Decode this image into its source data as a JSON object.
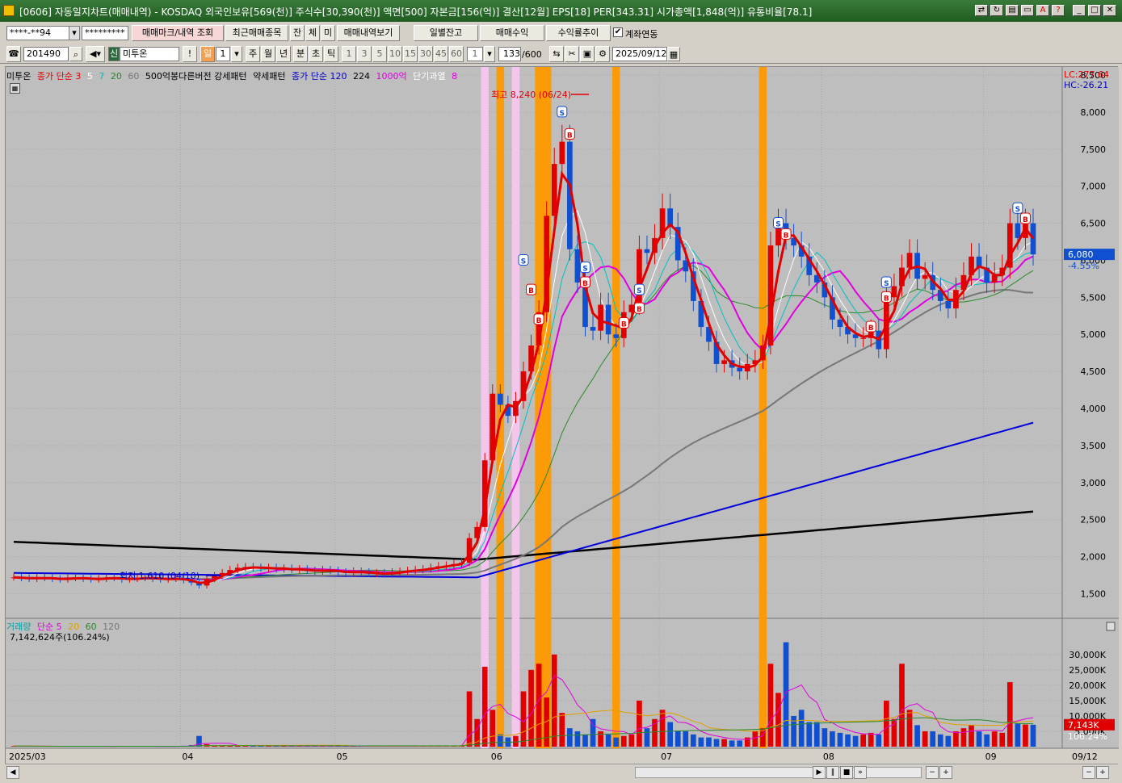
{
  "window": {
    "title": "[0606] 자동일지차트(매매내역) - KOSDAQ 외국인보유[569(천)] 주식수[30,390(천)] 액면[500] 자본금[156(억)] 결산[12월] EPS[18] PER[343.31] 시가총액[1,848(억)] 유통비율[78.1]"
  },
  "toolbar1": {
    "account": "****-**94",
    "password": "*********",
    "trade_mark_btn": "매매마크/내역 조회",
    "recent_trades_btn": "최근매매종목",
    "jan_btn": "잔",
    "che_btn": "체",
    "mi_btn": "미",
    "history_btn": "매매내역보기",
    "daily_balance_btn": "일별잔고",
    "trade_profit_btn": "매매수익",
    "return_trend_btn": "수익률추이",
    "account_link_label": "계좌연동",
    "account_link_checked": "✔"
  },
  "toolbar2": {
    "code": "201490",
    "badge": "신",
    "name": "미투온",
    "period_buttons": [
      "일",
      "1",
      "주",
      "월",
      "년",
      "분",
      "초",
      "틱"
    ],
    "interval_buttons": [
      "1",
      "3",
      "5",
      "10",
      "15",
      "30",
      "45",
      "60"
    ],
    "interval_sel": "1",
    "count": "133",
    "count_max": "/600",
    "date": "2025/09/12"
  },
  "legend": {
    "stock": "미투온",
    "ma_label": "종가 단순 3",
    "ma5": "5",
    "ma7": "7",
    "ma20": "20",
    "ma60": "60",
    "pattern": "500억봉다른버전 강세패턴",
    "weak": "약세패턴",
    "ma_label2": "종가 단순 120",
    "ma224": "224",
    "big": "1000억",
    "short": "단기과열",
    "short_val": "8"
  },
  "price_panel": {
    "lc": "LC:277.64",
    "hc": "HC:-26.21",
    "current": "6,080",
    "change": "-4.55%",
    "high_note": "최고 8,240 (06/24)",
    "low_note": "최저 1,610 (04/10)",
    "y_ticks": [
      "8,500",
      "8,000",
      "7,500",
      "7,000",
      "6,500",
      "6,000",
      "5,500",
      "5,000",
      "4,500",
      "4,000",
      "3,500",
      "3,000",
      "2,500",
      "2,000",
      "1,500"
    ]
  },
  "volume_panel": {
    "legend_label": "거래량",
    "ma_label": "단순 5",
    "ma20": "20",
    "ma60": "60",
    "ma120": "120",
    "summary": "7,142,624주(106.24%)",
    "current": "7,143K",
    "percent": "106.24%",
    "y_ticks": [
      "30,000K",
      "25,000K",
      "20,000K",
      "15,000K",
      "10,000K",
      "5,000K"
    ]
  },
  "x_axis": {
    "labels": [
      "2025/03",
      "04",
      "05",
      "06",
      "07",
      "08",
      "09"
    ],
    "last": "09/12"
  },
  "chart_data": {
    "type": "candlestick",
    "x_labels": [
      "2025/03",
      "04",
      "05",
      "06",
      "07",
      "08",
      "09"
    ],
    "ylim": [
      1200,
      8500
    ],
    "close": [
      1720,
      1710,
      1700,
      1720,
      1710,
      1700,
      1690,
      1710,
      1720,
      1700,
      1690,
      1700,
      1720,
      1710,
      1690,
      1700,
      1710,
      1720,
      1700,
      1690,
      1700,
      1710,
      1680,
      1650,
      1610,
      1700,
      1740,
      1780,
      1820,
      1850,
      1860,
      1850,
      1840,
      1850,
      1830,
      1840,
      1820,
      1830,
      1810,
      1800,
      1820,
      1810,
      1790,
      1780,
      1800,
      1790,
      1770,
      1780,
      1760,
      1790,
      1800,
      1810,
      1820,
      1830,
      1850,
      1870,
      1880,
      1900,
      1920,
      2250,
      2400,
      3300,
      4200,
      4050,
      3900,
      4100,
      4500,
      4850,
      5300,
      6600,
      7300,
      7600,
      6150,
      5700,
      5100,
      5050,
      5400,
      5000,
      4950,
      5300,
      5400,
      6150,
      6100,
      6300,
      6700,
      6450,
      6000,
      5850,
      5450,
      5100,
      4900,
      4600,
      4650,
      4550,
      4500,
      4600,
      4650,
      4850,
      6200,
      6500,
      6300,
      6200,
      6050,
      5800,
      5700,
      5500,
      5200,
      5100,
      5000,
      4950,
      4950,
      5050,
      4800,
      5500,
      5650,
      5900,
      6100,
      5750,
      5800,
      5600,
      5450,
      5350,
      5600,
      5800,
      6050,
      5900,
      5700,
      5800,
      5900,
      6500,
      6300,
      6500,
      6080
    ],
    "volume": [
      200,
      150,
      180,
      120,
      110,
      130,
      100,
      150,
      160,
      120,
      110,
      100,
      140,
      120,
      130,
      110,
      100,
      150,
      110,
      120,
      100,
      90,
      300,
      500,
      3500,
      800,
      400,
      350,
      300,
      280,
      260,
      240,
      230,
      250,
      220,
      210,
      200,
      190,
      180,
      200,
      190,
      180,
      170,
      160,
      170,
      150,
      160,
      150,
      140,
      160,
      170,
      180,
      200,
      220,
      240,
      260,
      280,
      300,
      400,
      18000,
      9000,
      26000,
      12000,
      4000,
      3000,
      3500,
      18000,
      25000,
      27000,
      16000,
      30000,
      11000,
      6000,
      5000,
      4000,
      9000,
      5000,
      4000,
      3000,
      3500,
      4000,
      15000,
      6000,
      9000,
      12000,
      8000,
      5000,
      5000,
      4000,
      3000,
      3000,
      2500,
      2500,
      2000,
      2000,
      3000,
      5000,
      6000,
      27000,
      17500,
      34000,
      10000,
      12000,
      8000,
      8000,
      6000,
      5000,
      4500,
      4000,
      3500,
      4000,
      4500,
      4000,
      15000,
      9000,
      27000,
      12000,
      7000,
      5000,
      5000,
      4000,
      3500,
      5000,
      6000,
      7000,
      5000,
      4000,
      5000,
      4500,
      21000,
      7500,
      7200,
      7143
    ]
  }
}
